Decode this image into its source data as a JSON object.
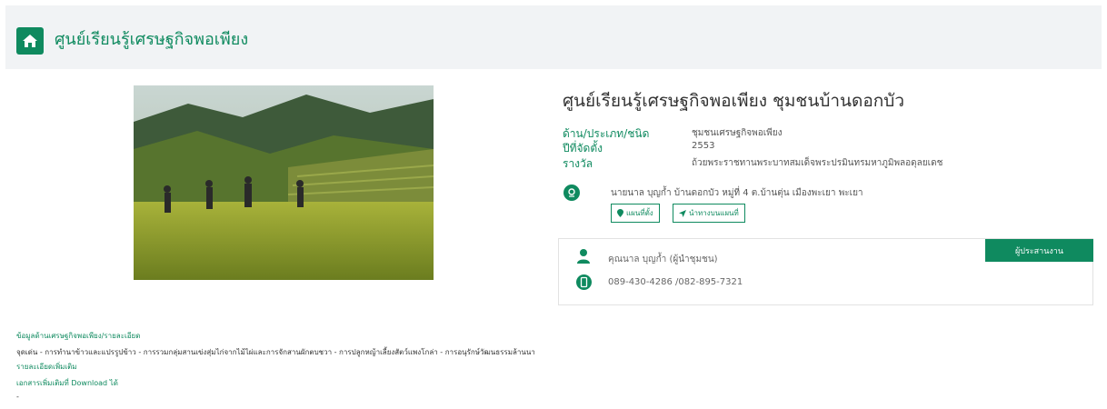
{
  "header": {
    "title": "ศูนย์เรียนรู้เศรษฐกิจพอเพียง"
  },
  "center": {
    "title": "ศูนย์เรียนรู้เศรษฐกิจพอเพียง ชุมชนบ้านดอกบัว",
    "info": [
      {
        "label": "ด้าน/ประเภท/ชนิด",
        "value": "ชุมชนเศรษฐกิจพอเพียง"
      },
      {
        "label": "ปีที่จัดตั้ง",
        "value": "2553"
      },
      {
        "label": "รางวัล",
        "value": "ถ้วยพระราชทานพระบาทสมเด็จพระปรมินทรมหาภูมิพลอดุลยเดช"
      }
    ],
    "address": "นายนาล บุญก้ำ บ้านดอกบัว หมู่ที่ 4 ต.บ้านตุ่น เมืองพะเยา พะเยา",
    "map_button": "แผนที่ตั้ง",
    "directions_button": "นำทางบนแผนที่"
  },
  "coordinator": {
    "button": "ผู้ประสานงาน",
    "name": "คุณนาล บุญก้ำ (ผู้นำชุมชน)",
    "phone": "089-430-4286 /082-895-7321"
  },
  "details": {
    "heading": "ข้อมูลด้านเศรษฐกิจพอเพียง/รายละเอียด",
    "highlights": "จุดเด่น - การทำนาข้าวและแปรรูปข้าว - การรวมกลุ่มสานเข่งสุ่มไก่จากไม้ไผ่และการจักสานผักตบชวา - การปลูกหญ้าเลี้ยงสัตว์แพงโกล่า - การอนุรักษ์วัฒนธรรมล้านนา",
    "more_label": "รายละเอียดเพิ่มเติม",
    "download_label": "เอกสารเพิ่มเติมที่ Download ได้",
    "download_value": "-"
  },
  "colors": {
    "accent": "#0f8a5f",
    "header_bg": "#f1f3f5"
  }
}
